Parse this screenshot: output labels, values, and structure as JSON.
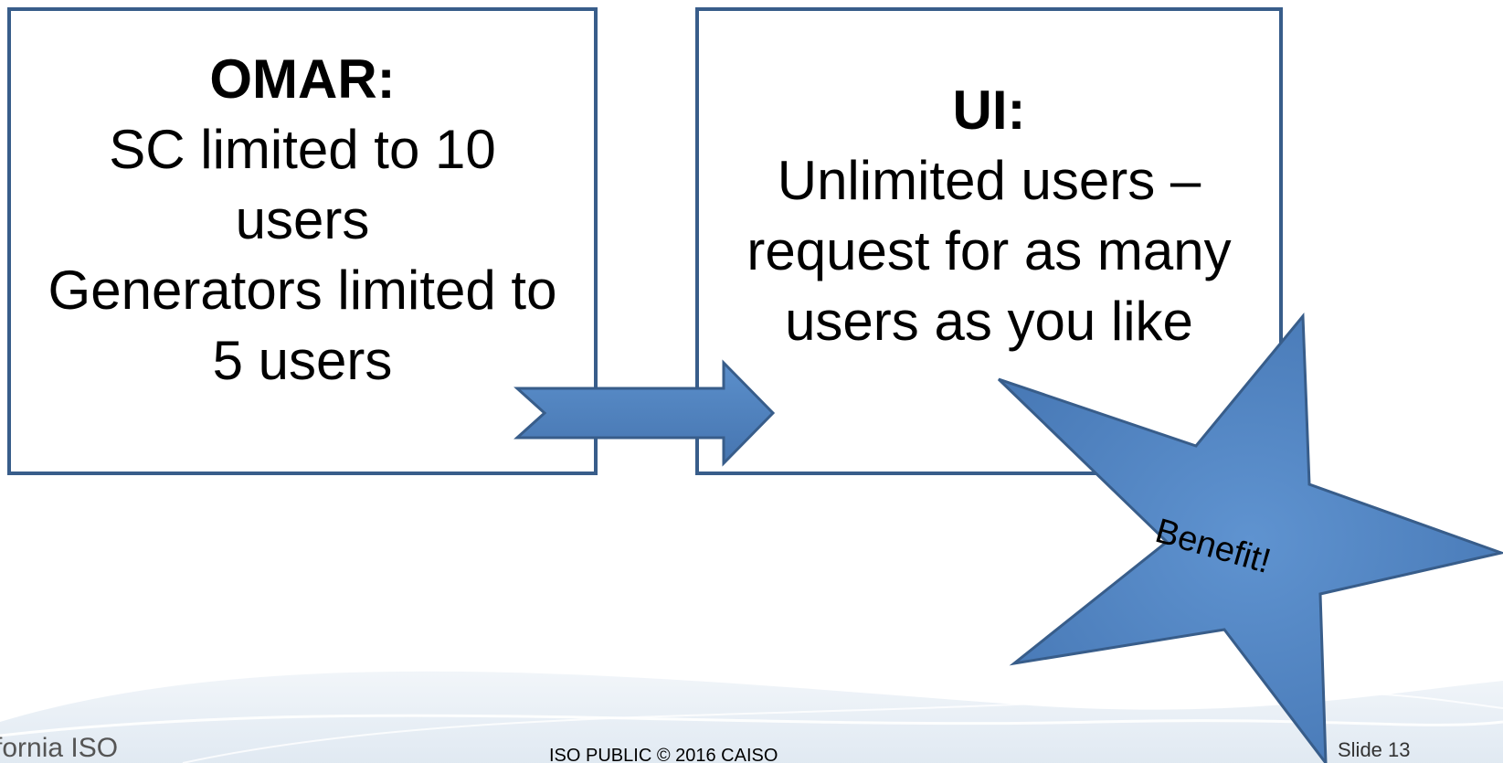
{
  "left_box": {
    "title": "OMAR:",
    "lines": [
      "SC limited to 10",
      "users",
      "Generators limited to",
      "5 users"
    ]
  },
  "right_box": {
    "title": "UI:",
    "lines": [
      "Unlimited users –",
      "request for as many",
      "users as you like"
    ]
  },
  "star": {
    "label": "Benefit!"
  },
  "footer": {
    "logo_text": "fornia ISO",
    "center": "ISO PUBLIC  © 2016 CAISO",
    "slide_number": "Slide 13"
  },
  "colors": {
    "box_border": "#385d8a",
    "shape_fill": "#4f81bd",
    "shape_outline": "#385d8a"
  }
}
